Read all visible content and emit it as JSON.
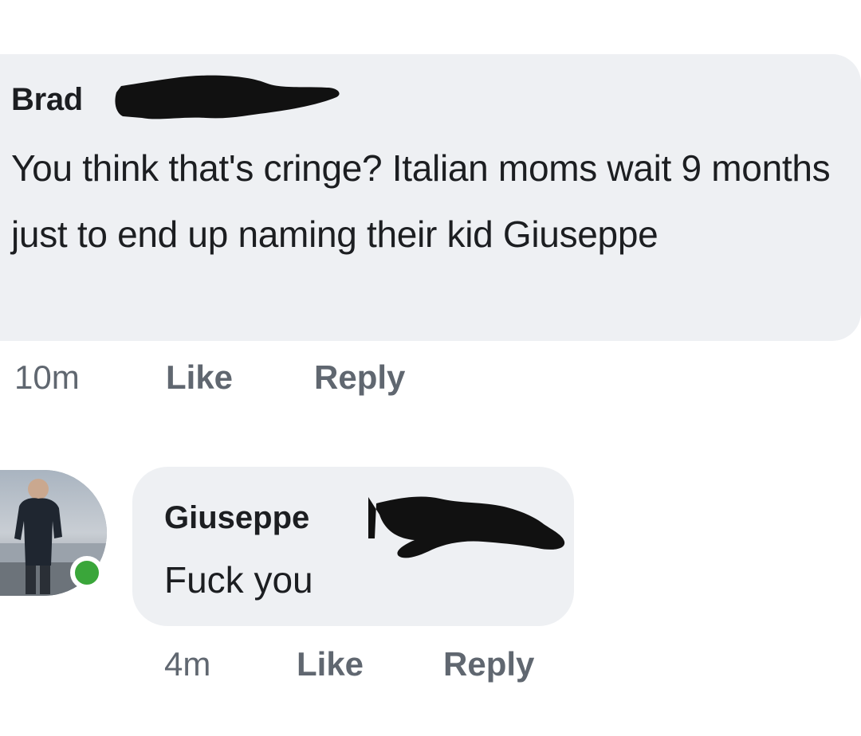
{
  "comment": {
    "author": "Brad",
    "text": "You think that's cringe? Italian moms wait 9 months just to end up naming their kid Giuseppe",
    "time": "10m",
    "like_label": "Like",
    "reply_label": "Reply"
  },
  "reply": {
    "author": "Giuseppe",
    "text": "Fuck you",
    "time": "4m",
    "like_label": "Like",
    "reply_label": "Reply",
    "avatar_icon": "profile-photo",
    "online": true
  },
  "colors": {
    "bubble": "#eef0f3",
    "meta_text": "#606770",
    "online_dot": "#3aa63a",
    "redaction": "#111111"
  }
}
